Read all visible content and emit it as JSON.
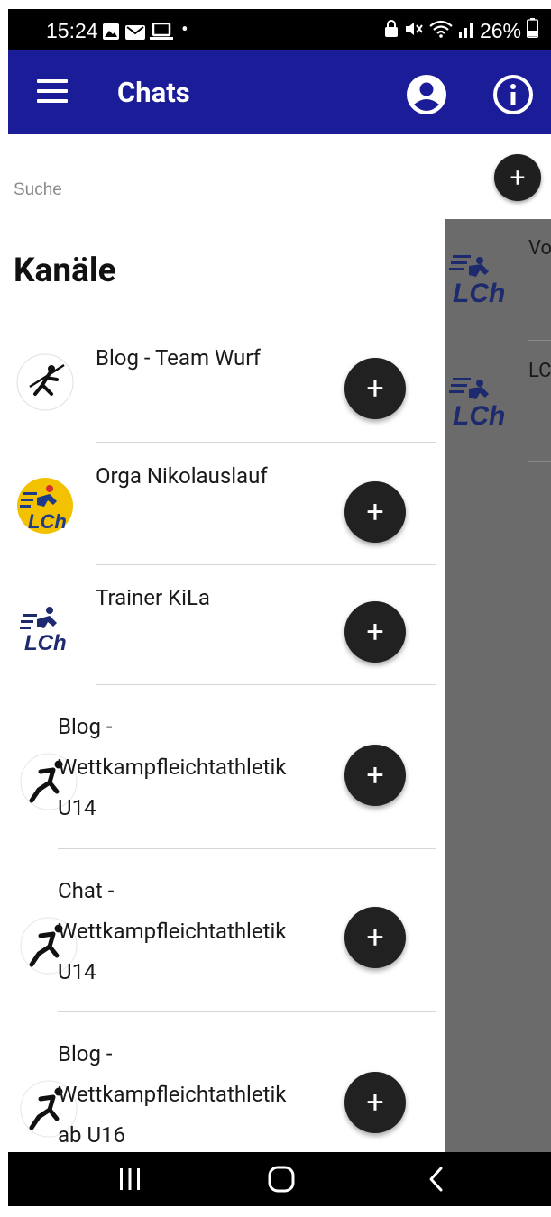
{
  "status_bar": {
    "time": "15:24",
    "dot": "•",
    "battery": "26%",
    "left_icons": [
      "gallery-icon",
      "mail-icon",
      "laptop-icon"
    ],
    "right_icons": [
      "lock-icon",
      "mute-icon",
      "wifi-icon",
      "signal-icon",
      "battery-icon"
    ]
  },
  "app_bar": {
    "title": "Chats",
    "background": "#1b1c98",
    "icons": [
      "menu-icon",
      "account-icon",
      "info-icon"
    ]
  },
  "drawer": {
    "search_placeholder": "Suche",
    "section_title": "Kanäle",
    "channels": [
      {
        "lines": [
          "Blog - Team Wurf"
        ],
        "logo": "javelin-logo-icon"
      },
      {
        "lines": [
          "Orga Nikolauslauf"
        ],
        "logo": "lch-yellow-logo-icon"
      },
      {
        "lines": [
          "Trainer KiLa"
        ],
        "logo": "lch-logo-icon"
      },
      {
        "lines": [
          "Blog -",
          "Wettkampfleichtathletik",
          "U14"
        ],
        "logo": "runner-logo-icon"
      },
      {
        "lines": [
          "Chat -",
          "Wettkampfleichtathletik",
          "U14"
        ],
        "logo": "runner-logo-icon"
      },
      {
        "lines": [
          "Blog -",
          "Wettkampfleichtathletik",
          "ab U16"
        ],
        "logo": "runner-logo-icon"
      }
    ],
    "add_button_label": "+"
  },
  "main": {
    "add_button_label": "+",
    "chats": [
      {
        "name": "Vo",
        "logo": "lch-logo-icon"
      },
      {
        "name": "LC",
        "logo": "lch-logo-icon"
      }
    ]
  },
  "nav_bar": {
    "icons": [
      "recent-apps-icon",
      "home-icon",
      "back-icon"
    ]
  }
}
